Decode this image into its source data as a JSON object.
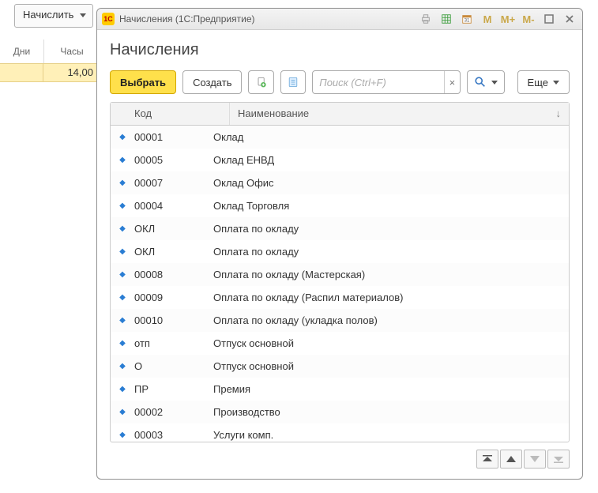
{
  "background": {
    "accrue_label": "Начислить",
    "days_header": "Дни",
    "hours_header": "Часы",
    "days_value": "",
    "hours_value": "14,00"
  },
  "dialog": {
    "title": "Начисления  (1С:Предприятие)",
    "heading": "Начисления",
    "toolbar": {
      "select_label": "Выбрать",
      "create_label": "Создать",
      "more_label": "Еще",
      "search_placeholder": "Поиск (Ctrl+F)"
    },
    "columns": {
      "code": "Код",
      "name": "Наименование"
    },
    "rows": [
      {
        "code": "00001",
        "name": "Оклад"
      },
      {
        "code": "00005",
        "name": "Оклад ЕНВД"
      },
      {
        "code": "00007",
        "name": "Оклад Офис"
      },
      {
        "code": "00004",
        "name": "Оклад Торговля"
      },
      {
        "code": "ОКЛ",
        "name": "Оплата по окладу"
      },
      {
        "code": "ОКЛ",
        "name": "Оплата по окладу"
      },
      {
        "code": "00008",
        "name": "Оплата по окладу (Мастерская)"
      },
      {
        "code": "00009",
        "name": "Оплата по окладу (Распил материалов)"
      },
      {
        "code": "00010",
        "name": "Оплата по окладу (укладка полов)"
      },
      {
        "code": "отп",
        "name": "Отпуск основной"
      },
      {
        "code": "О",
        "name": "Отпуск основной"
      },
      {
        "code": "ПР",
        "name": "Премия"
      },
      {
        "code": "00002",
        "name": "Производство"
      },
      {
        "code": "00003",
        "name": "Услуги комп."
      }
    ],
    "mem_buttons": {
      "m": "M",
      "mplus": "M+",
      "mminus": "M-"
    }
  }
}
